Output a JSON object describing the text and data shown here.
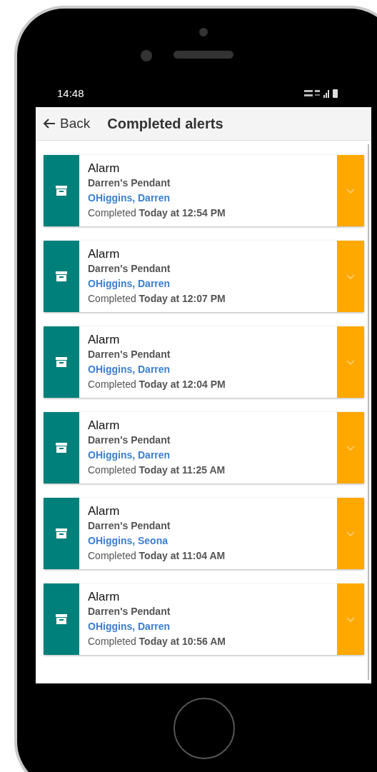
{
  "status_bar": {
    "time": "14:48"
  },
  "header": {
    "back": "Back",
    "title": "Completed alerts"
  },
  "alerts": [
    {
      "type": "Alarm",
      "device": "Darren's Pendant",
      "person": "OHiggins, Darren",
      "completed": "Completed **Today at 12:54 PM**"
    },
    {
      "type": "Alarm",
      "device": "Darren's Pendant",
      "person": "OHiggins, Darren",
      "completed": "Completed **Today at 12:07 PM**"
    },
    {
      "type": "Alarm",
      "device": "Darren's Pendant",
      "person": "OHiggins, Darren",
      "completed": "Completed **Today at 12:04 PM**"
    },
    {
      "type": "Alarm",
      "device": "Darren's Pendant",
      "person": "OHiggins, Darren",
      "completed": "Completed **Today at 11:25 AM**"
    },
    {
      "type": "Alarm",
      "device": "Darren's Pendant",
      "person": "OHiggins, Seona",
      "completed": "Completed **Today at 11:04 AM**"
    },
    {
      "type": "Alarm",
      "device": "Darren's Pendant",
      "person": "OHiggins, Darren",
      "completed": "Completed **Today at 10:56 AM**"
    }
  ]
}
